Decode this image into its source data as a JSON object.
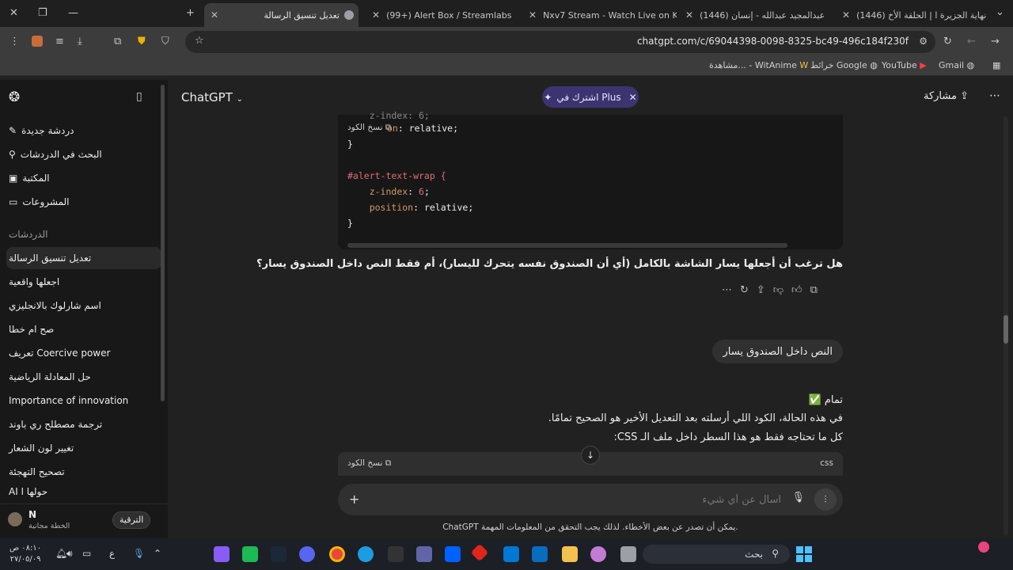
{
  "browser": {
    "tabs": [
      {
        "title": "(1446) نهاية الجزيرة ا | الحلقة الأخ",
        "active": false
      },
      {
        "title": "(1446) عبدالمجيد عبدالله - إنسان",
        "active": false
      },
      {
        "title": "Nxv7 Stream - Watch Live on K",
        "active": false
      },
      {
        "title": "(99+) Alert Box / Streamlabs",
        "active": false
      },
      {
        "title": "تعديل تنسيق الرسالة",
        "active": true
      }
    ],
    "url": "chatgpt.com/c/69044398-0098-8325-bc49-496c184f230f",
    "bookmarks": [
      "Gmail",
      "YouTube",
      "خرائط Google",
      "مشاهدة... - WitAnime"
    ]
  },
  "sidebar": {
    "nav": [
      "دردشة جديدة",
      "البحث في الدردشات",
      "المكتبة",
      "المشروعات"
    ],
    "chats_heading": "الدردشات",
    "chats": [
      "تعديل تنسيق الرسالة",
      "اجعلها واقعية",
      "اسم شارلوك بالانجليزي",
      "صح ام خطا",
      "تعريف Coercive power",
      "حل المعادلة الرياضية",
      "Importance of innovation",
      "ترجمة مصطلح ري باوند",
      "تغيير لون الشعار",
      "تصحيح التهجئة",
      "AI حولها ا"
    ],
    "user": {
      "initial": "N",
      "plan": "الخطة مجانية",
      "upgrade": "الترقية"
    }
  },
  "topbar": {
    "title": "ChatGPT",
    "plus_pill": "اشترك في Plus",
    "share": "مشاركة"
  },
  "code_block_1": {
    "copy_label": "نسخ الكود",
    "lines": [
      "    z-index: 6;",
      "    position: relative;",
      "}",
      "",
      "#alert-text-wrap {",
      "    z-index: 6;",
      "    position: relative;",
      "}"
    ]
  },
  "assistant_question": "هل ترغب أن أجعلها يسار الشاشة بالكامل (أي أن الصندوق نفسه يتحرك لليسار)، أم فقط النص داخل الصندوق يسار؟",
  "user_message": "النص داخل الصندوق يسار",
  "assistant_answer": {
    "line1": "تمام ✅",
    "line2": "في هذه الحالة، الكود اللي أرسلته بعد التعديل الأخير هو الصحيح تمامًا.",
    "line3": "كل ما تحتاجه فقط هو هذا السطر داخل ملف الـ CSS:"
  },
  "code_block_2": {
    "lang": "css",
    "copy_label": "نسخ الكود"
  },
  "composer": {
    "placeholder": "اسأل عن أي شيء"
  },
  "disclaimer": "ChatGPT يمكن أن تصدر عن بعض الأخطاء. لذلك يجب التحقق من المعلومات المهمة.",
  "taskbar": {
    "search_placeholder": "بحث",
    "time": "٠٨:١٠ ص",
    "date": "٢٧/٠٥/٠٩",
    "lang": "ع"
  }
}
